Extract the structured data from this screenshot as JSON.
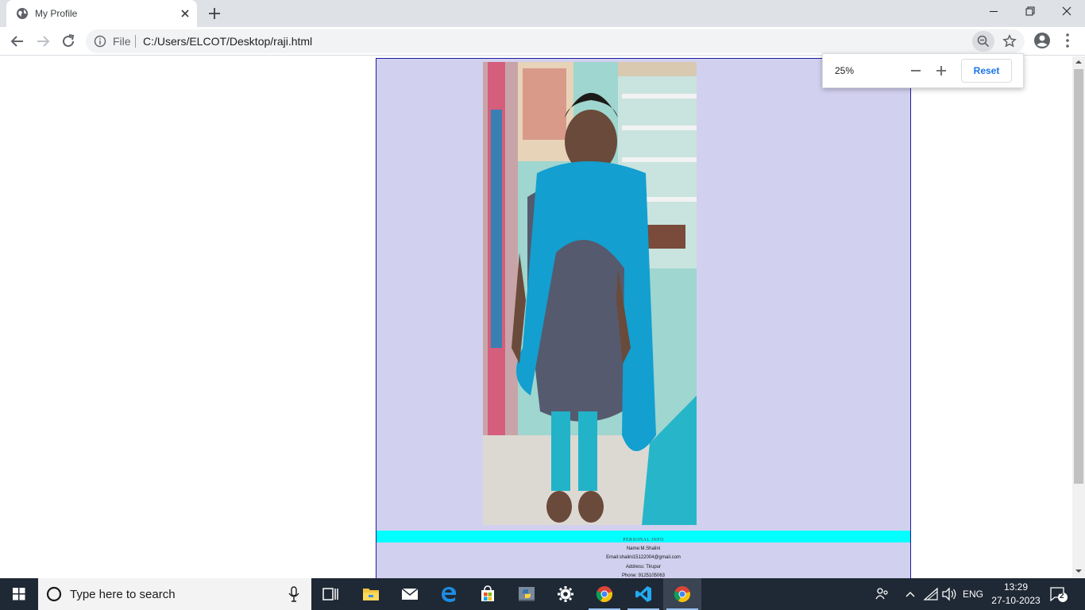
{
  "browser": {
    "tab_title": "My Profile",
    "omnibox_scheme_label": "File",
    "url": "C:/Users/ELCOT/Desktop/raji.html",
    "zoom": {
      "level": "25%",
      "reset_label": "Reset"
    }
  },
  "page": {
    "section_heading": "PERSONAL INFO",
    "info": {
      "name": "Name:M.Shalini",
      "email": "Email:shalini15122004@gmail.com",
      "address": "Address: Tirupur",
      "phone": "Phone: 9125105063"
    }
  },
  "taskbar": {
    "search_placeholder": "Type here to search",
    "language": "ENG",
    "time": "13:29",
    "date": "27-10-2023",
    "notification_count": "2",
    "apps": [
      "task-view",
      "file-explorer",
      "mail",
      "edge",
      "store",
      "python-idle",
      "settings",
      "chrome",
      "vscode",
      "chrome"
    ]
  },
  "colors": {
    "card_bg": "#d2d0ef",
    "banner": "#00ffff",
    "accent": "#1a73e8",
    "taskbar": "#1f2935"
  }
}
